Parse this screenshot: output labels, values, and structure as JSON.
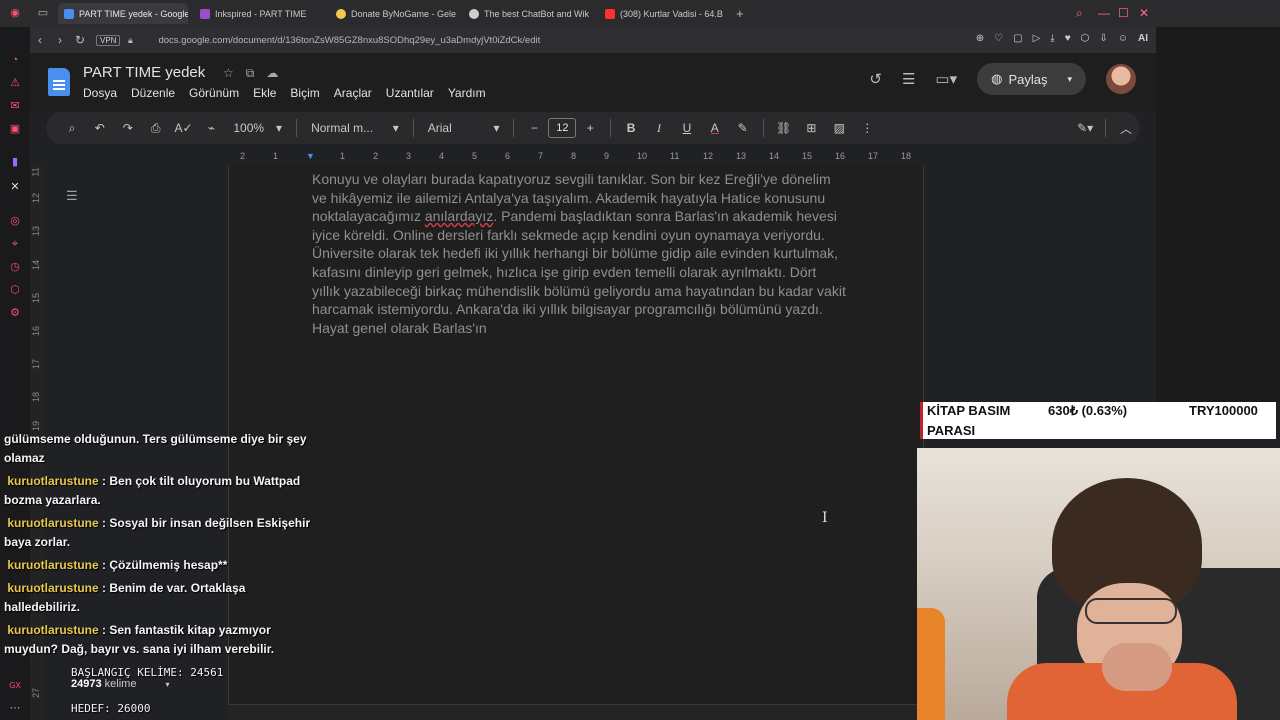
{
  "browser": {
    "tabs": [
      {
        "label": "PART TIME yedek - Google",
        "color": "#4a8ff0",
        "active": true
      },
      {
        "label": "Inkspired - PART TIME",
        "color": "#9b4dca",
        "active": false
      },
      {
        "label": "Donate ByNoGame - Gele",
        "color": "#f2c94c",
        "active": false
      },
      {
        "label": "The best ChatBot and Wik",
        "color": "#cfcfcf",
        "active": false
      },
      {
        "label": "(308) Kurtlar Vadisi - 64.B",
        "color": "#ff2d2d",
        "active": false
      }
    ],
    "new_tab": "+",
    "vpn": "VPN",
    "url": "docs.google.com/document/d/136tonZsW85GZ8nxu8SODhq29ey_u3aDmdyjVt0iZdCk/edit",
    "ai_label": "AI"
  },
  "docs": {
    "title": "PART TIME  yedek",
    "menu": [
      "Dosya",
      "Düzenle",
      "Görünüm",
      "Ekle",
      "Biçim",
      "Araçlar",
      "Uzantılar",
      "Yardım"
    ],
    "share_label": "Paylaş",
    "toolbar": {
      "zoom": "100%",
      "style": "Normal m...",
      "font": "Arial",
      "font_size": "12"
    },
    "ruler_numbers": [
      "2",
      "1",
      "1",
      "2",
      "3",
      "4",
      "5",
      "6",
      "7",
      "8",
      "9",
      "10",
      "11",
      "12",
      "13",
      "14",
      "15",
      "16",
      "17",
      "18"
    ],
    "vruler_numbers": [
      "11",
      "12",
      "13",
      "14",
      "15",
      "16",
      "17",
      "18",
      "19",
      "27"
    ]
  },
  "document": {
    "text_before": "Konuyu ve olayları burada kapatıyoruz sevgili tanıklar. Son bir kez Ereğli'ye dönelim ve hikâyemiz ile ailemizi Antalya'ya taşıyalım. Akademik hayatıyla Hatice konusunu noktalayacağımız ",
    "misspelled": "anılardayız",
    "text_after": ". Pandemi başladıktan sonra Barlas'ın akademik hevesi iyice köreldi. Online dersleri farklı sekmede açıp kendini oyun oynamaya veriyordu. Üniversite olarak tek hedefi iki yıllık herhangi bir bölüme gidip aile evinden kurtulmak, kafasını dinleyip geri gelmek, hızlıca işe girip evden temelli olarak ayrılmaktı. Dört yıllık yazabileceği birkaç mühendislik bölümü geliyordu ama hayatından bu kadar vakit harcamak istemiyordu. Ankara'da iki yıllık bilgisayar programcılığı bölümünü yazdı. Hayat genel olarak Barlas'ın"
  },
  "chat": {
    "partial": "gülümseme olduğunun. Ters gülümseme diye bir şey olamaz",
    "messages": [
      {
        "user": "kuruotlarustune",
        "text": "Ben çok tilt oluyorum bu Wattpad bozma yazarlara."
      },
      {
        "user": "kuruotlarustune",
        "text": "Sosyal bir insan değilsen Eskişehir baya zorlar."
      },
      {
        "user": "kuruotlarustune",
        "text": "Çözülmemiş hesap**"
      },
      {
        "user": "kuruotlarustune",
        "text": "Benim de var. Ortaklaşa halledebiliriz."
      },
      {
        "user": "kuruotlarustune",
        "text": "Sen fantastik kitap yazmıyor muydun? Dağ, bayır vs. sana iyi ilham verebilir."
      }
    ]
  },
  "overlay": {
    "start_words": "BAŞLANGIÇ KELİME: 24561",
    "word_count_num": "24973",
    "word_count_label": "kelime",
    "goal": "HEDEF: 26000",
    "ticker_label_1": "KİTAP BASIM",
    "ticker_label_2": "PARASI",
    "ticker_value": "630₺ (0.63%)",
    "ticker_goal": "TRY100000"
  }
}
